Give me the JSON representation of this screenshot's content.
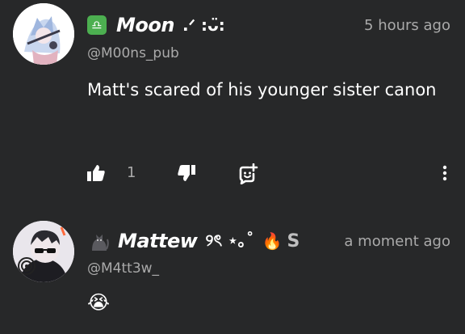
{
  "comments": [
    {
      "username": "Moon",
      "name_suffix": ".ᐟ :ᴗ̈:",
      "badge": "♎",
      "time": "5 hours ago",
      "handle": "@M00ns_pub",
      "text": "Matt's scared of his younger sister canon",
      "likes": "1",
      "icons": [
        "like-icon",
        "dislike-icon",
        "reply-icon",
        "more-icon"
      ]
    },
    {
      "username": "Mattew",
      "name_suffix": "୨ৎ ⋆｡˚",
      "name_emoji": "🔥",
      "name_cut": "S",
      "time": "a moment ago",
      "handle": "@M4tt3w_",
      "text": "😭"
    }
  ],
  "colors": {
    "background": "#272829",
    "secondary_text": "#aaaaaa",
    "badge_green": "#4caf50"
  }
}
